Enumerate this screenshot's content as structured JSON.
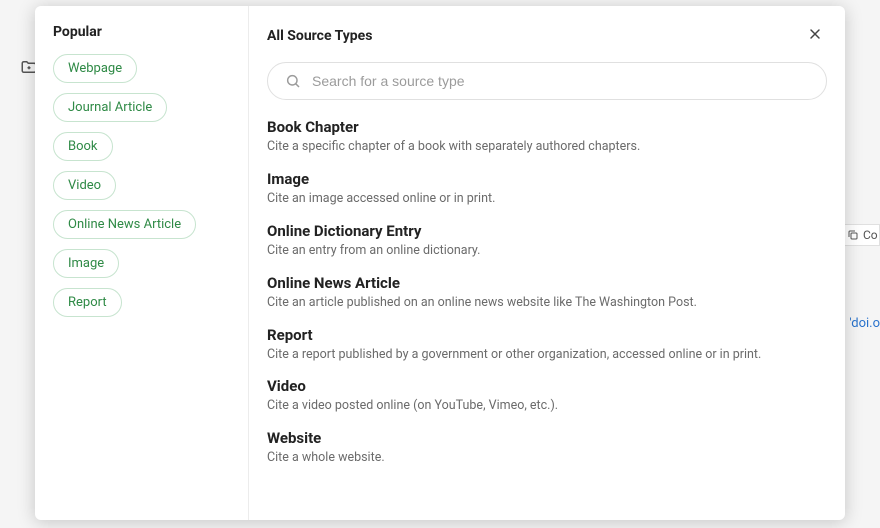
{
  "sidebar": {
    "heading": "Popular",
    "items": [
      {
        "label": "Webpage"
      },
      {
        "label": "Journal Article"
      },
      {
        "label": "Book"
      },
      {
        "label": "Video"
      },
      {
        "label": "Online News Article"
      },
      {
        "label": "Image"
      },
      {
        "label": "Report"
      }
    ]
  },
  "main": {
    "heading": "All Source Types",
    "search_placeholder": "Search for a source type",
    "types": [
      {
        "title": "Book Chapter",
        "desc": "Cite a specific chapter of a book with separately authored chapters."
      },
      {
        "title": "Image",
        "desc": "Cite an image accessed online or in print."
      },
      {
        "title": "Online Dictionary Entry",
        "desc": "Cite an entry from an online dictionary."
      },
      {
        "title": "Online News Article",
        "desc": "Cite an article published on an online news website like The Washington Post."
      },
      {
        "title": "Report",
        "desc": "Cite a report published by a government or other organization, accessed online or in print."
      },
      {
        "title": "Video",
        "desc": "Cite a video posted online (on YouTube, Vimeo, etc.)."
      },
      {
        "title": "Website",
        "desc": "Cite a whole website."
      }
    ]
  },
  "background": {
    "copy_hint": "Co",
    "link_hint": "'doi.o"
  }
}
